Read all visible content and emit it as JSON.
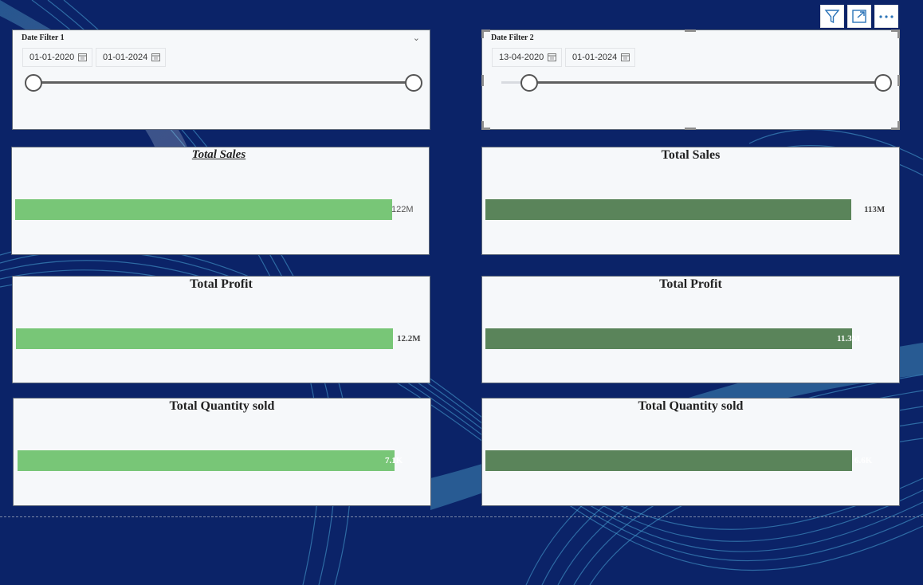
{
  "filters": [
    {
      "title": "Date Filter 1",
      "start_date": "01-01-2020",
      "end_date": "01-01-2024"
    },
    {
      "title": "Date Filter 2",
      "start_date": "13-04-2020",
      "end_date": "01-01-2024"
    }
  ],
  "left_kpis": [
    {
      "title": "Total Sales",
      "value_label": "122M",
      "fill": 0.946
    },
    {
      "title": "Total Profit",
      "value_label": "12.2M",
      "fill": 0.946
    },
    {
      "title": "Total Quantity sold",
      "value_label": "7.1K",
      "fill": 0.946
    }
  ],
  "right_kpis": [
    {
      "title": "Total Sales",
      "value_label": "113M",
      "fill": 0.917
    },
    {
      "title": "Total Profit",
      "value_label": "11.3M",
      "fill": 0.919
    },
    {
      "title": "Total Quantity sold",
      "value_label": "6.6K",
      "fill": 0.919
    }
  ],
  "toolbar": {
    "icons": [
      "filter-icon",
      "focus-mode-icon",
      "more-options-icon"
    ]
  },
  "colors": {
    "background": "#0b2368",
    "bar_light": "#78c677",
    "bar_dark": "#5a845a",
    "card": "#f6f8fa"
  }
}
